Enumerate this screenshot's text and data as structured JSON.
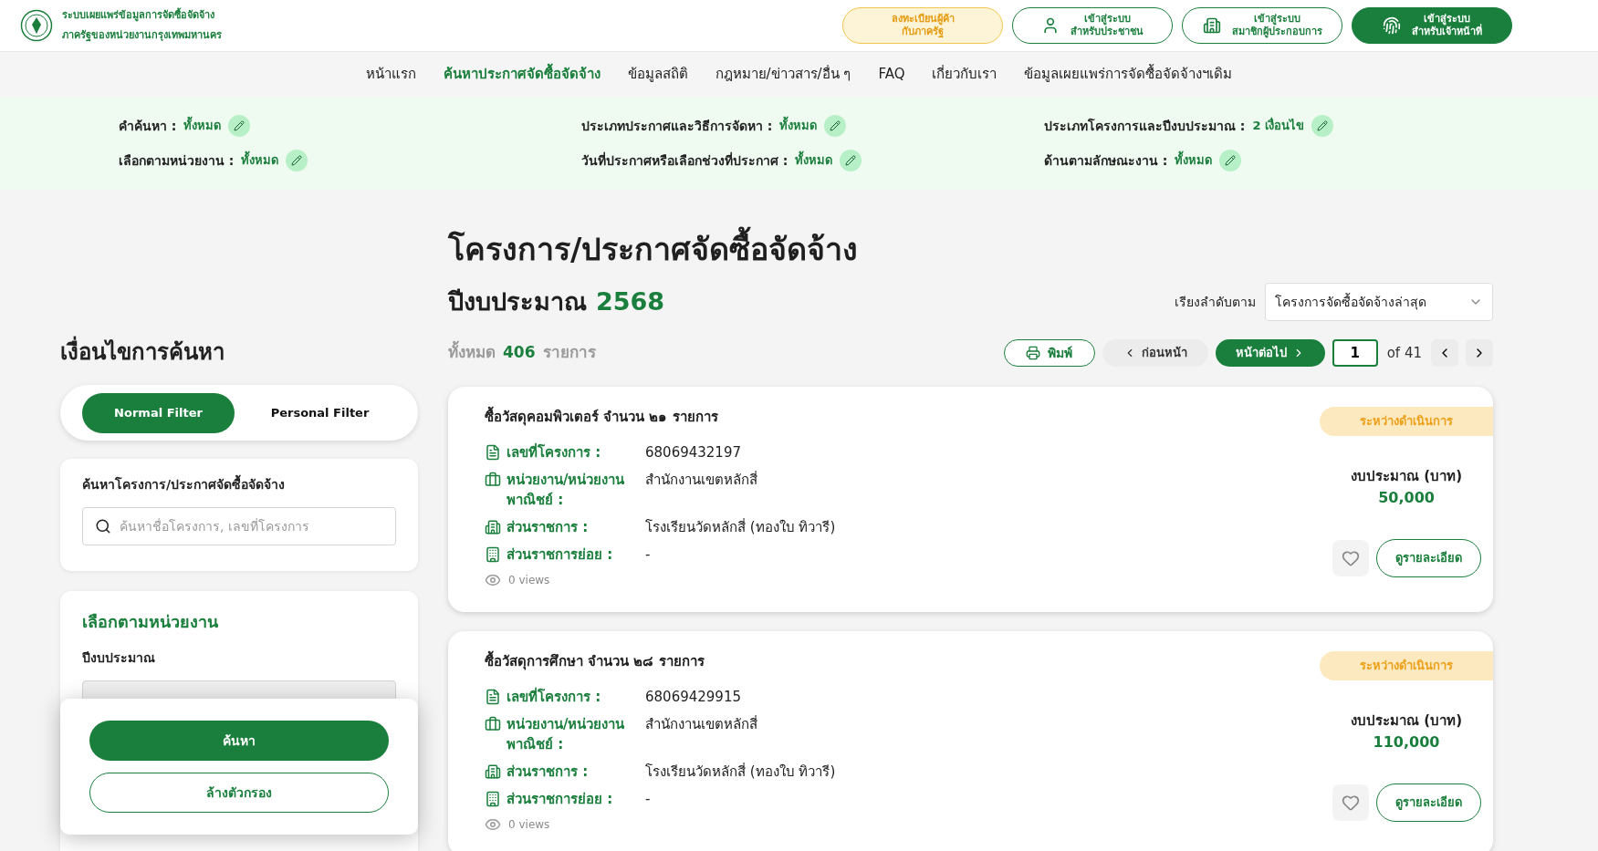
{
  "header": {
    "site_title_lines": [
      "ระบบเผยแพร่ข้อมูลการจัดซื้อจัดจ้าง",
      "ภาครัฐของหน่วยงานกรุงเทพมหานคร"
    ],
    "buttons": [
      {
        "kind": "register",
        "lines": [
          "ลงทะเบียนผู้ค้า",
          "กับภาครัฐ"
        ]
      },
      {
        "kind": "citizen",
        "lines": [
          "เข้าสู่ระบบ",
          "สำหรับประชาชน"
        ]
      },
      {
        "kind": "member",
        "lines": [
          "เข้าสู่ระบบ",
          "สมาชิกผู้ประกอบการ"
        ]
      },
      {
        "kind": "officer",
        "lines": [
          "เข้าสู่ระบบ",
          "สำหรับเจ้าหน้าที่"
        ]
      }
    ]
  },
  "nav": [
    {
      "label": "หน้าแรก",
      "selected": false
    },
    {
      "label": "ค้นหาประกาศจัดซื้อจัดจ้าง",
      "selected": true
    },
    {
      "label": "ข้อมูลสถิติ",
      "selected": false
    },
    {
      "label": "กฎหมาย/ข่าวสาร/อื่น ๆ",
      "selected": false
    },
    {
      "label": "FAQ",
      "selected": false
    },
    {
      "label": "เกี่ยวกับเรา",
      "selected": false
    },
    {
      "label": "ข้อมูลเผยแพร่การจัดซื้อจัดจ้างฯเดิม",
      "selected": false
    }
  ],
  "filter_summary": [
    {
      "label": "คำค้นหา :",
      "value": "ทั้งหมด"
    },
    {
      "label": "ประเภทประกาศและวิธีการจัดหา :",
      "value": "ทั้งหมด"
    },
    {
      "label": "ประเภทโครงการและปีงบประมาณ :",
      "value": "2 เงื่อนไข"
    },
    {
      "label": "เลือกตามหน่วยงาน :",
      "value": "ทั้งหมด"
    },
    {
      "label": "วันที่ประกาศหรือเลือกช่วงที่ประกาศ :",
      "value": "ทั้งหมด"
    },
    {
      "label": "ด้านตามลักษณะงาน :",
      "value": "ทั้งหมด"
    }
  ],
  "sidebar": {
    "title": "เงื่อนไขการค้นหา",
    "filter_tabs": [
      {
        "label": "Normal Filter",
        "selected": true
      },
      {
        "label": "Personal Filter",
        "selected": false
      }
    ],
    "search_label": "ค้นหาโครงการ/ประกาศจัดซื้อจัดจ้าง",
    "search": {
      "placeholder": "ค้นหาชื่อโครงการ, เลขที่โครงการ"
    },
    "unit_section": {
      "title": "เลือกตามหน่วยงาน",
      "year_label": "ปีงบประมาณ"
    },
    "actions": {
      "search_button": "ค้นหา",
      "clear_button": "ล้างตัวกรอง"
    }
  },
  "main": {
    "title": "โครงการ/ประกาศจัดซื้อจัดจ้าง",
    "year_label": "ปีงบประมาณ",
    "year": "2568",
    "sort_label": "เรียงลำดับตาม",
    "sort_value": "โครงการจัดซื้อจัดจ้างล่าสุด",
    "total_prefix": "ทั้งหมด",
    "total": "406",
    "total_suffix": "รายการ",
    "print_button": "พิมพ์",
    "prev_button": "ก่อนหน้า",
    "next_button": "หน้าต่อไป",
    "page": "1",
    "page_of": "of 41"
  },
  "projects": [
    {
      "title": "ซื้อวัสดุคอมพิวเตอร์ จำนวน ๒๑ รายการ",
      "status": "ระหว่างดำเนินการ",
      "fields": [
        {
          "kind": "document",
          "label": "เลขที่โครงการ :",
          "value": "68069432197"
        },
        {
          "kind": "briefcase",
          "label": "หน่วยงาน/หน่วยงานพาณิชย์ :",
          "value": "สำนักงานเขตหลักสี่"
        },
        {
          "kind": "building",
          "label": "ส่วนราชการ :",
          "value": "โรงเรียนวัดหลักสี่ (ทองใบ ทิวารี)"
        },
        {
          "kind": "office",
          "label": "ส่วนราชการย่อย :",
          "value": "-"
        }
      ],
      "views": "0 views",
      "budget_label": "งบประมาณ (บาท)",
      "budget": "50,000",
      "favorite": false,
      "detail_button": "ดูรายละเอียด"
    },
    {
      "title": "ซื้อวัสดุการศึกษา จำนวน ๒๘ รายการ",
      "status": "ระหว่างดำเนินการ",
      "fields": [
        {
          "kind": "document",
          "label": "เลขที่โครงการ :",
          "value": "68069429915"
        },
        {
          "kind": "briefcase",
          "label": "หน่วยงาน/หน่วยงานพาณิชย์ :",
          "value": "สำนักงานเขตหลักสี่"
        },
        {
          "kind": "building",
          "label": "ส่วนราชการ :",
          "value": "โรงเรียนวัดหลักสี่ (ทองใบ ทิวารี)"
        },
        {
          "kind": "office",
          "label": "ส่วนราชการย่อย :",
          "value": "-"
        }
      ],
      "views": "0 views",
      "budget_label": "งบประมาณ (บาท)",
      "budget": "110,000",
      "favorite": false,
      "detail_button": "ดูรายละเอียด"
    }
  ]
}
